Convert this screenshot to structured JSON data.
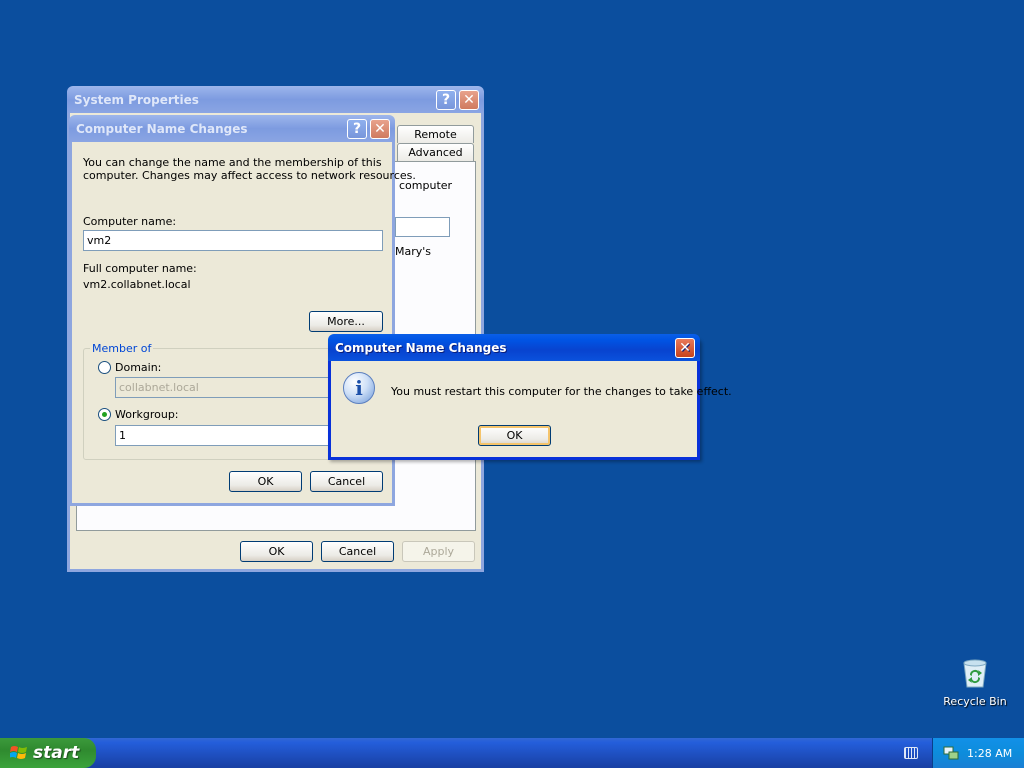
{
  "system_properties": {
    "title": "System Properties",
    "tabs": [
      "Remote",
      "Advanced"
    ],
    "partial_texts": [
      "computer",
      "Mary's"
    ],
    "buttons": {
      "ok": "OK",
      "cancel": "Cancel",
      "apply": "Apply"
    }
  },
  "name_changes": {
    "title": "Computer Name Changes",
    "description_line1": "You can change the name and the membership of this",
    "description_line2": "computer. Changes may affect access to network resources.",
    "computer_name_label": "Computer name:",
    "computer_name_value": "vm2",
    "full_name_label": "Full computer name:",
    "full_name_value": "vm2.collabnet.local",
    "more_button": "More...",
    "member_of_label": "Member of",
    "domain_label": "Domain:",
    "domain_value": "collabnet.local",
    "workgroup_label": "Workgroup:",
    "workgroup_value": "1",
    "ok_button": "OK",
    "cancel_button": "Cancel"
  },
  "message_box": {
    "title": "Computer Name Changes",
    "message": "You must restart this computer for the changes to take effect.",
    "ok_button": "OK",
    "icon": "info-icon"
  },
  "desktop": {
    "recycle_bin_label": "Recycle Bin"
  },
  "taskbar": {
    "start_label": "start",
    "clock": "1:28 AM"
  },
  "colors": {
    "desktop": "#0b4e9e",
    "active_title": "#0055e5",
    "inactive_title": "#7d9be0",
    "dialog_face": "#ece9d8"
  }
}
